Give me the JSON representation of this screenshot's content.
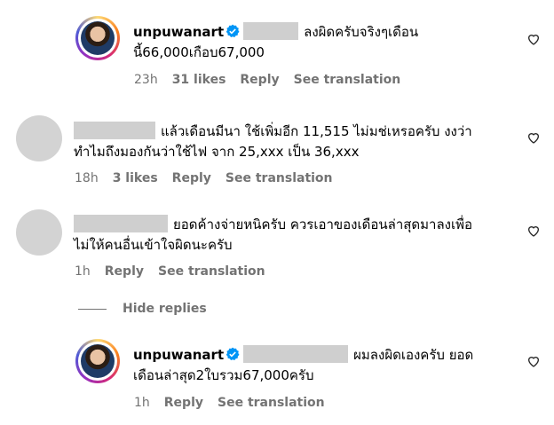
{
  "comments": [
    {
      "username": "unpuwanart",
      "line1": "ลงผิดครับจริงๆเดือน",
      "line2": "นี้66,000เกือบ67,000",
      "time": "23h",
      "likes": "31 likes",
      "reply": "Reply",
      "see_translation": "See translation"
    },
    {
      "username": "",
      "line1": "แล้วเดือนมีนา ใช้เพิ่มอีก 11,515 ไม่มช่เหรอครับ งงว่า",
      "line2": "ทำไมถึงมองกันว่าใช้ไฟ จาก 25,xxx เป็น 36,xxx",
      "time": "18h",
      "likes": "3 likes",
      "reply": "Reply",
      "see_translation": "See translation"
    },
    {
      "username": "",
      "line1": "ยอดค้างจ่ายหนิครับ ควรเอาของเดือนล่าสุดมาลงเพื่อ",
      "line2": "ไม่ให้คนอื่นเข้าใจผิดนะครับ",
      "time": "1h",
      "reply": "Reply",
      "see_translation": "See translation"
    },
    {
      "username": "unpuwanart",
      "line1": "ผมลงผิดเองครับ ยอด",
      "line2": "เดือนล่าสุด2ใบรวม67,000ครับ",
      "time": "1h",
      "reply": "Reply",
      "see_translation": "See translation"
    }
  ],
  "hide_replies": "Hide replies",
  "colors": {
    "verified": "#0095f6",
    "meta": "#737373",
    "redact": "#cfcfcf"
  },
  "icons": {
    "like": "heart-icon",
    "verified": "verified-badge-icon"
  }
}
